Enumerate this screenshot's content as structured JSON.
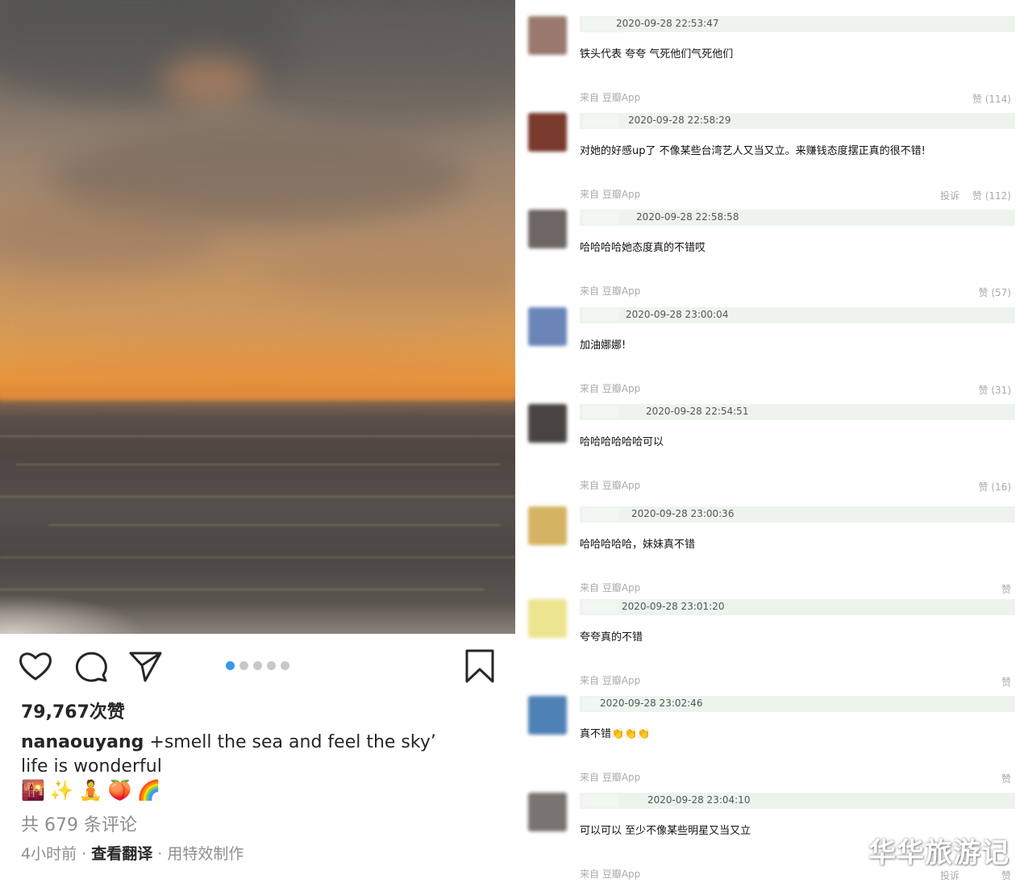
{
  "post": {
    "likes": "79,767次赞",
    "username": "nanaouyang",
    "caption_text": " +smell the sea and feel the sky’ life is wonderful",
    "emojis": [
      "🌇",
      "✨",
      "🧘",
      "🍑",
      "🌈"
    ],
    "comment_count": "共 679 条评论",
    "time_ago": "4小时前",
    "separator": " · ",
    "translate": "查看翻译",
    "effects": "用特效制作",
    "carousel_total": 5,
    "carousel_active": 1,
    "icons": [
      "heart-icon",
      "comment-icon",
      "share-icon",
      "bookmark-icon"
    ],
    "accent": "#3897f0"
  },
  "comments": [
    {
      "time": "2020-09-28 22:53:47",
      "text": "铁头代表 夸夸 气死他们气死他们",
      "source": "来自 豆瓣App",
      "vote": "赞 (114)",
      "report": "",
      "avatar_color": "#9a7a6e"
    },
    {
      "time": "2020-09-28 22:58:29",
      "text": "对她的好感up了 不像某些台湾艺人又当又立。来赚钱态度摆正真的很不错!",
      "source": "来自 豆瓣App",
      "vote": "赞 (112)",
      "report": "投诉",
      "avatar_color": "#7a3a2e"
    },
    {
      "time": "2020-09-28 22:58:58",
      "text": "哈哈哈哈她态度真的不错哎",
      "source": "来自 豆瓣App",
      "vote": "赞 (57)",
      "report": "",
      "avatar_color": "#6e6662"
    },
    {
      "time": "2020-09-28 23:00:04",
      "text": "加油娜娜!",
      "source": "来自 豆瓣App",
      "vote": "赞 (31)",
      "report": "",
      "avatar_color": "#6a86b8"
    },
    {
      "time": "2020-09-28 22:54:51",
      "text": "哈哈哈哈哈哈可以",
      "source": "来自 豆瓣App",
      "vote": "赞 (16)",
      "report": "",
      "avatar_color": "#4a4440"
    },
    {
      "time": "2020-09-28 23:00:36",
      "text": "哈哈哈哈哈，妹妹真不错",
      "source": "来自 豆瓣App",
      "vote": "赞",
      "report": "",
      "avatar_color": "#d4b462"
    },
    {
      "time": "2020-09-28 23:01:20",
      "text": "夸夸真的不错",
      "source": "来自 豆瓣App",
      "vote": "赞",
      "report": "",
      "avatar_color": "#ece48e"
    },
    {
      "time": "2020-09-28 23:02:46",
      "text": "真不错👏👏👏",
      "source": "来自 豆瓣App",
      "vote": "赞",
      "report": "",
      "avatar_color": "#4e82b4"
    },
    {
      "time": "2020-09-28 23:04:10",
      "text": "可以可以 至少不像某些明星又当又立",
      "source": "来自 豆瓣App",
      "vote": "赞",
      "report": "投诉",
      "avatar_color": "#7a7470"
    }
  ],
  "watermark": "华华旅游记"
}
